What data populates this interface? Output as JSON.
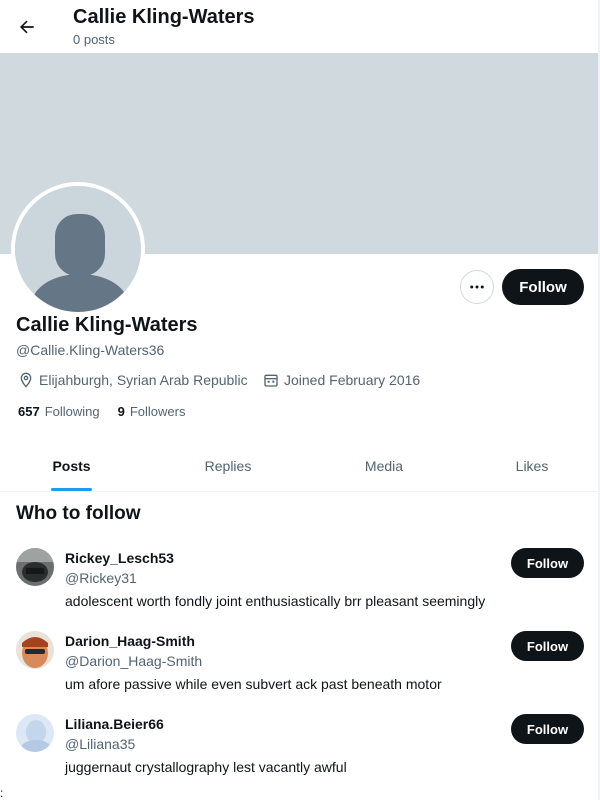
{
  "header": {
    "back_icon": "arrow-left-icon",
    "name": "Callie Kling-Waters",
    "posts": "0 posts"
  },
  "colors": {
    "banner": "#cfd9de",
    "accent": "#1d9bf0",
    "button": "#0f1419",
    "secondary_text": "#536471"
  },
  "profile": {
    "name": "Callie Kling-Waters",
    "handle": "@Callie.Kling-Waters36",
    "follow_label": "Follow",
    "more_icon": "more-horizontal-icon",
    "location": "Elijahburgh, Syrian Arab Republic",
    "joined": "Joined February 2016",
    "following_count": "657",
    "following_label": "Following",
    "followers_count": "9",
    "followers_label": "Followers"
  },
  "tabs": [
    {
      "label": "Posts",
      "active": true
    },
    {
      "label": "Replies",
      "active": false
    },
    {
      "label": "Media",
      "active": false
    },
    {
      "label": "Likes",
      "active": false
    }
  ],
  "who_to_follow": {
    "title": "Who to follow",
    "users": [
      {
        "name": "Rickey_Lesch53",
        "handle": "@Rickey31",
        "bio": "adolescent worth fondly joint enthusiastically brr pleasant seemingly",
        "follow_label": "Follow"
      },
      {
        "name": "Darion_Haag-Smith",
        "handle": "@Darion_Haag-Smith",
        "bio": "um afore passive while even subvert ack past beneath motor",
        "follow_label": "Follow"
      },
      {
        "name": "Liliana.Beier66",
        "handle": "@Liliana35",
        "bio": "juggernaut crystallography lest vacantly awful",
        "follow_label": "Follow"
      }
    ]
  },
  "footer_mark": ":"
}
